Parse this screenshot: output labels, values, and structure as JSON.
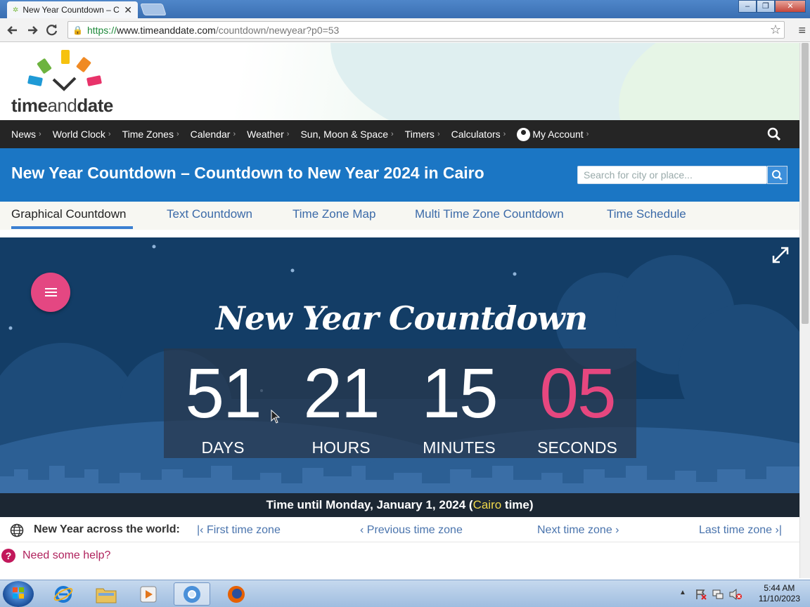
{
  "browser": {
    "tab_title": "New Year Countdown – C",
    "url": {
      "secure": "https://",
      "host": "www.timeanddate.com",
      "path": "/countdown/newyear?p0=53"
    }
  },
  "site": {
    "logo_time": "time",
    "logo_and": "and",
    "logo_date": "date",
    "nav": [
      "News",
      "World Clock",
      "Time Zones",
      "Calendar",
      "Weather",
      "Sun, Moon & Space",
      "Timers",
      "Calculators"
    ],
    "account": "My Account",
    "page_title": "New Year Countdown – Countdown to New Year 2024 in Cairo",
    "search_placeholder": "Search for city or place...",
    "subnav": [
      "Graphical Countdown",
      "Text Countdown",
      "Time Zone Map",
      "Multi Time Zone Countdown",
      "Time Schedule"
    ]
  },
  "countdown": {
    "title": "New Year Countdown",
    "days": "51",
    "hours": "21",
    "minutes": "15",
    "seconds": "05",
    "days_label": "DAYS",
    "hours_label": "HOURS",
    "minutes_label": "MINUTES",
    "seconds_label": "SECONDS",
    "footer_prefix": "Time until Monday, January 1, 2024 (",
    "footer_city": "Cairo",
    "footer_suffix": " time)"
  },
  "world": {
    "label": "New Year across the world:",
    "first": "First time zone",
    "previous": "Previous time zone",
    "next": "Next time zone",
    "last": "Last time zone"
  },
  "help": {
    "icon": "?",
    "text": "Need some help?"
  },
  "taskbar": {
    "time": "5:44 AM",
    "date": "11/10/2023"
  },
  "colors": {
    "nav_bg": "#252525",
    "title_bg": "#1b76c4",
    "hero_bg": "#133d66",
    "accent_pink": "#e6477f"
  }
}
